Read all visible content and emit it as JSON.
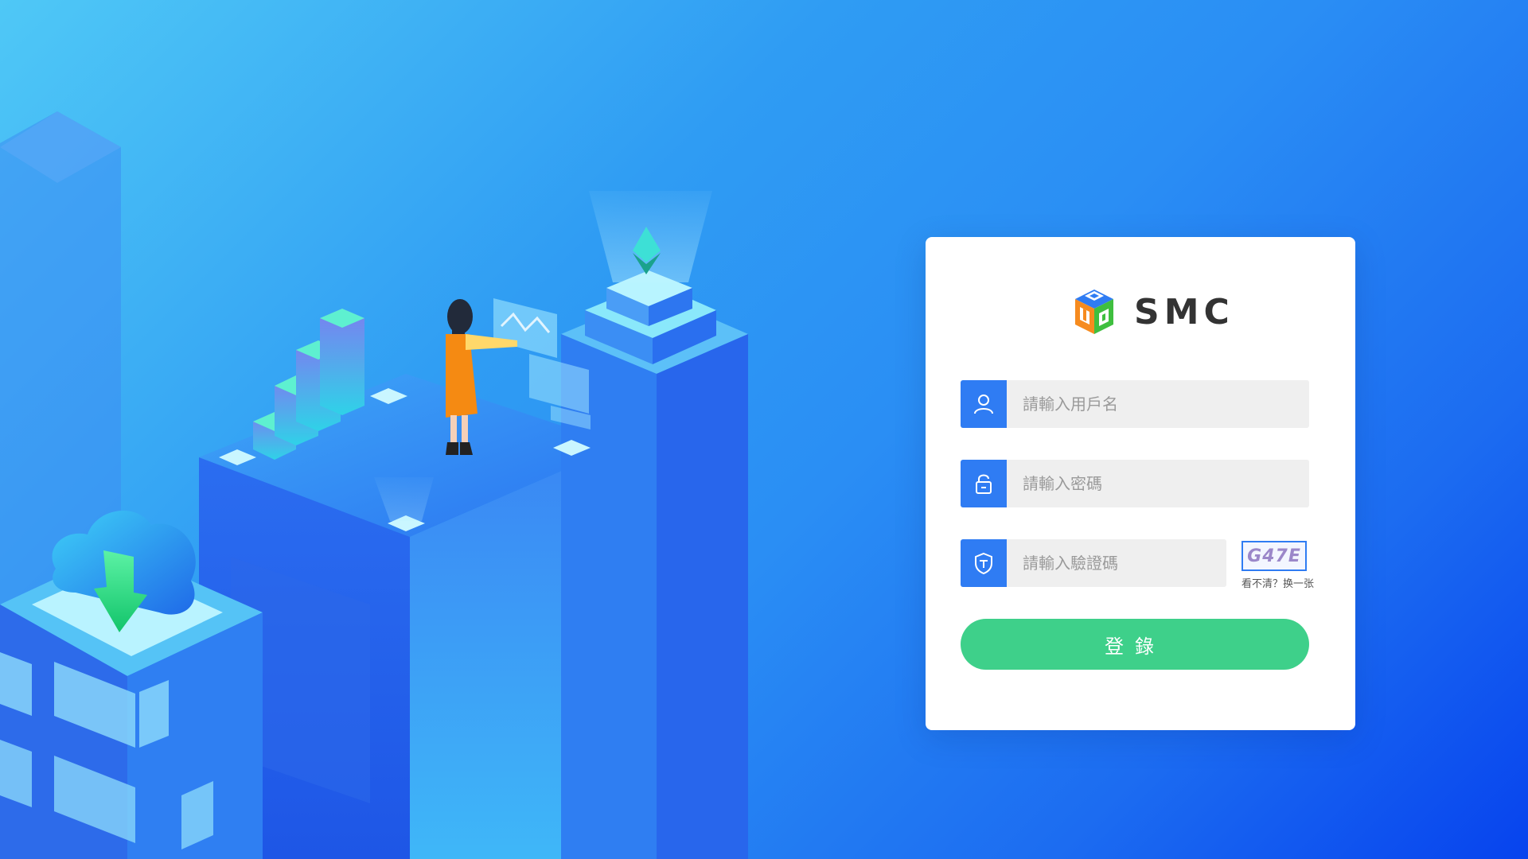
{
  "brand": {
    "name": "SMC",
    "logo_colors": [
      "#f68b1f",
      "#2f7cf3",
      "#3fbf3f"
    ]
  },
  "login": {
    "username_placeholder": "請輸入用戶名",
    "password_placeholder": "請輸入密碼",
    "captcha_placeholder": "請輸入驗證碼",
    "captcha_code": "G47E",
    "captcha_refresh": "看不清？换一张",
    "submit_label": "登錄"
  },
  "icons": {
    "username": "user-icon",
    "password": "lock-icon",
    "captcha": "shield-icon"
  },
  "colors": {
    "accent": "#2f7cf3",
    "button": "#3ed08a",
    "input_bg": "#efefef"
  }
}
